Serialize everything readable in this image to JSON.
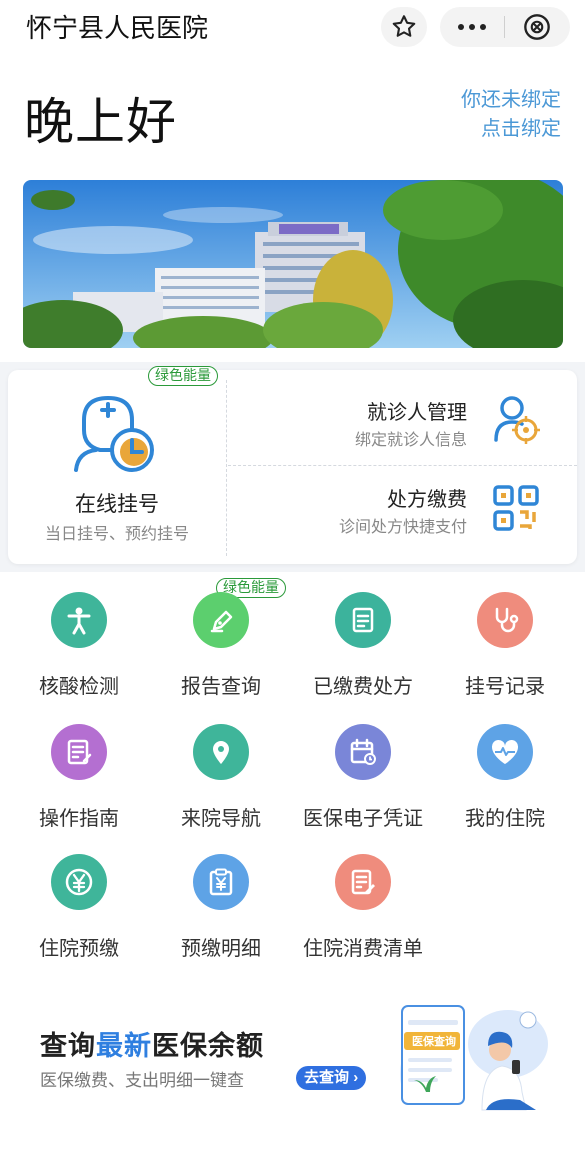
{
  "header": {
    "title": "怀宁县人民医院",
    "star_icon": "star-icon",
    "more_icon": "more-icon",
    "close_icon": "close-circle-icon"
  },
  "greeting": {
    "text": "晚上好",
    "bind_line1": "你还未绑定",
    "bind_line2": "点击绑定"
  },
  "services": {
    "badge": "绿色能量",
    "registration": {
      "title": "在线挂号",
      "subtitle": "当日挂号、预约挂号"
    },
    "patient": {
      "title": "就诊人管理",
      "subtitle": "绑定就诊人信息"
    },
    "prescription": {
      "title": "处方缴费",
      "subtitle": "诊间处方快捷支付"
    }
  },
  "grid": {
    "badge": "绿色能量",
    "items": [
      {
        "label": "核酸检测",
        "icon": "person-icon",
        "color": "#3fb59a"
      },
      {
        "label": "报告查询",
        "icon": "pen-icon",
        "color": "#5ccf6e"
      },
      {
        "label": "已缴费处方",
        "icon": "document-icon",
        "color": "#3cb39c"
      },
      {
        "label": "挂号记录",
        "icon": "stethoscope-icon",
        "color": "#ef8c7d"
      },
      {
        "label": "操作指南",
        "icon": "guide-icon",
        "color": "#b46fd1"
      },
      {
        "label": "来院导航",
        "icon": "location-icon",
        "color": "#3fb59a"
      },
      {
        "label": "医保电子凭证",
        "icon": "calendar-icon",
        "color": "#7a86d8"
      },
      {
        "label": "我的住院",
        "icon": "heart-icon",
        "color": "#5ea3e6"
      },
      {
        "label": "住院预缴",
        "icon": "yen-circle-icon",
        "color": "#3fb59a"
      },
      {
        "label": "预缴明细",
        "icon": "yen-clipboard-icon",
        "color": "#5ea3e6"
      },
      {
        "label": "住院消费清单",
        "icon": "edit-document-icon",
        "color": "#ef8c7d"
      }
    ]
  },
  "promo": {
    "title_pre": "查询",
    "title_highlight": "最新",
    "title_post": "医保余额",
    "subtitle": "医保缴费、支出明细一键查",
    "button": "去查询",
    "art_label": "医保查询"
  },
  "colors": {
    "accent": "#2f7fe0",
    "link": "#4b98d6",
    "green_badge": "#2b9a3a"
  }
}
